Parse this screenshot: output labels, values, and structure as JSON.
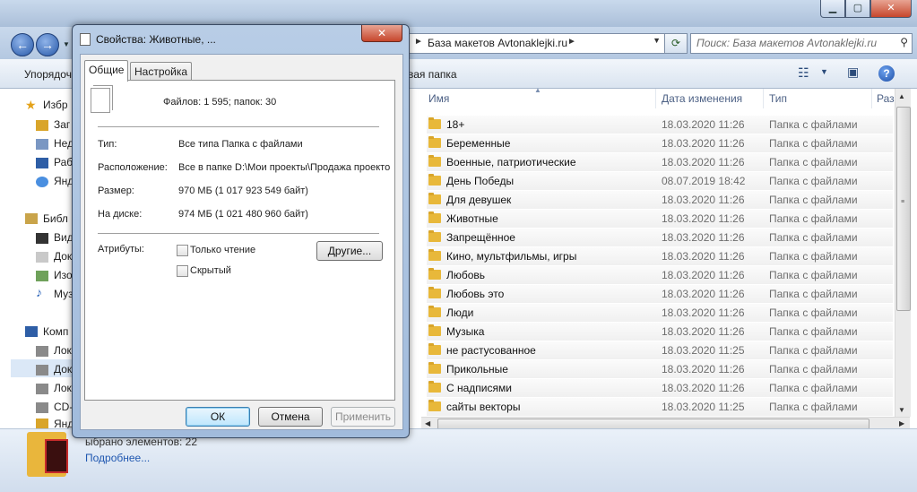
{
  "explorer": {
    "address": {
      "path": "База макетов Avtonaklejki.ru"
    },
    "search": {
      "placeholder": "Поиск: База макетов Avtonaklejki.ru"
    },
    "toolbar": {
      "organize": "Упорядоч",
      "new_folder": "вая папка"
    },
    "nav": {
      "favorites": "Избр",
      "items_fav": [
        "Заг",
        "Нед",
        "Раб",
        "Янд"
      ],
      "libraries": "Библ",
      "items_lib": [
        "Вид",
        "Док",
        "Изо",
        "Муз"
      ],
      "computer": "Комп",
      "items_comp": [
        "Лок",
        "Док",
        "Лок",
        "CD-",
        "Янд"
      ]
    },
    "columns": {
      "name": "Имя",
      "date": "Дата изменения",
      "type": "Тип",
      "size": "Раз"
    },
    "rows": [
      {
        "name": "18+",
        "date": "18.03.2020 11:26",
        "type": "Папка с файлами"
      },
      {
        "name": "Беременные",
        "date": "18.03.2020 11:26",
        "type": "Папка с файлами"
      },
      {
        "name": "Военные, патриотические",
        "date": "18.03.2020 11:26",
        "type": "Папка с файлами"
      },
      {
        "name": "День Победы",
        "date": "08.07.2019 18:42",
        "type": "Папка с файлами"
      },
      {
        "name": "Для девушек",
        "date": "18.03.2020 11:26",
        "type": "Папка с файлами"
      },
      {
        "name": "Животные",
        "date": "18.03.2020 11:26",
        "type": "Папка с файлами"
      },
      {
        "name": "Запрещённое",
        "date": "18.03.2020 11:26",
        "type": "Папка с файлами"
      },
      {
        "name": "Кино, мультфильмы, игры",
        "date": "18.03.2020 11:26",
        "type": "Папка с файлами"
      },
      {
        "name": "Любовь",
        "date": "18.03.2020 11:26",
        "type": "Папка с файлами"
      },
      {
        "name": "Любовь это",
        "date": "18.03.2020 11:26",
        "type": "Папка с файлами"
      },
      {
        "name": "Люди",
        "date": "18.03.2020 11:26",
        "type": "Папка с файлами"
      },
      {
        "name": "Музыка",
        "date": "18.03.2020 11:26",
        "type": "Папка с файлами"
      },
      {
        "name": "не растусованное",
        "date": "18.03.2020 11:25",
        "type": "Папка с файлами"
      },
      {
        "name": "Прикольные",
        "date": "18.03.2020 11:26",
        "type": "Папка с файлами"
      },
      {
        "name": "С надписями",
        "date": "18.03.2020 11:26",
        "type": "Папка с файлами"
      },
      {
        "name": "сайты векторы",
        "date": "18.03.2020 11:25",
        "type": "Папка с файлами"
      }
    ],
    "details": {
      "count": "ыбрано элементов: 22",
      "more": "Подробнее..."
    }
  },
  "dialog": {
    "title": "Свойства: Животные, ...",
    "tabs": [
      "Общие",
      "Настройка"
    ],
    "summary": "Файлов: 1 595; папок: 30",
    "labels": {
      "type": "Тип:",
      "location": "Расположение:",
      "size": "Размер:",
      "disk": "На диске:",
      "attributes": "Атрибуты:"
    },
    "values": {
      "type": "Все типа Папка с файлами",
      "location": "Все в папке D:\\Мои проекты\\Продажа проекто",
      "size": "970 МБ (1 017 923 549 байт)",
      "disk": "974 МБ (1 021 480 960 байт)"
    },
    "attributes": {
      "readonly": "Только чтение",
      "hidden": "Скрытый",
      "other": "Другие..."
    },
    "buttons": {
      "ok": "ОК",
      "cancel": "Отмена",
      "apply": "Применить"
    }
  }
}
